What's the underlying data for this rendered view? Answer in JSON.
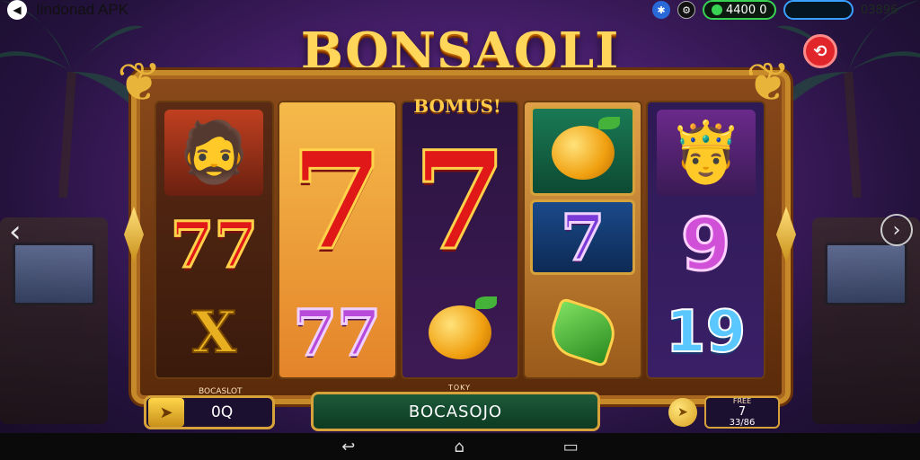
{
  "status": {
    "app_title": "Iindonad APK",
    "coins": "4400 0",
    "gems": "03896"
  },
  "game": {
    "title": "BONSAOLI",
    "banner": "BOMUS!"
  },
  "reels": {
    "r1": [
      "portrait-bandit",
      "77",
      "X"
    ],
    "r2": [
      "7",
      "77"
    ],
    "r3": [
      "7",
      "fruit"
    ],
    "r4": [
      "fruit",
      "7",
      "bar"
    ],
    "r5": [
      "portrait-king",
      "9",
      "19"
    ]
  },
  "bottom": {
    "bet_label": "BOCASLOT",
    "bet_value": "0Q",
    "spin_label_small": "TOKY",
    "spin_label": "BOCASOJO",
    "win_label": "FREE",
    "win_value": "7",
    "win_sub": "33/86"
  },
  "icons": [
    "back-icon",
    "bluetooth-icon",
    "settings-icon",
    "coin-icon",
    "close-icon",
    "chevron-left-icon",
    "chevron-right-icon",
    "nav-back-icon",
    "nav-home-icon",
    "nav-recent-icon"
  ],
  "colors": {
    "title_gold": "#ffd55a",
    "frame": "#c78a2a",
    "coins_border": "#39d353",
    "gem_border": "#3aa0ff",
    "close_red": "#e0262a"
  }
}
